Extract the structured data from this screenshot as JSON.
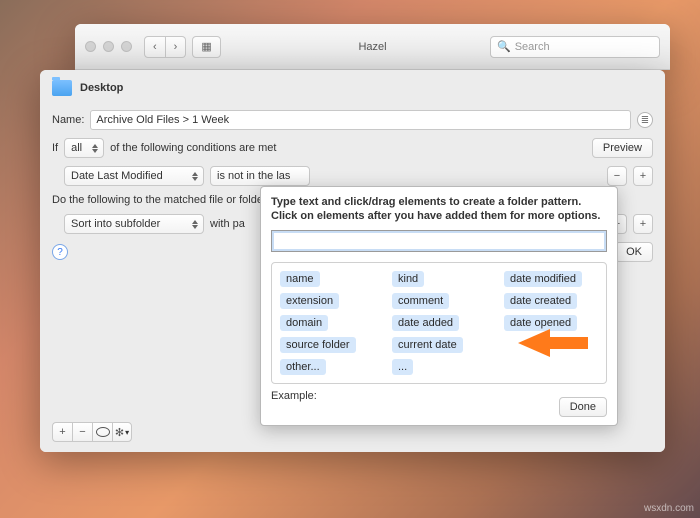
{
  "backWindow": {
    "title": "Hazel",
    "searchPlaceholder": "Search"
  },
  "header": {
    "folder": "Desktop"
  },
  "nameRow": {
    "label": "Name:",
    "value": "Archive Old Files > 1 Week"
  },
  "cond": {
    "ifLabel": "If",
    "allLabel": "all",
    "rest": "of the following conditions are met",
    "previewLabel": "Preview",
    "field": "Date Last Modified",
    "op": "is not in the las"
  },
  "action": {
    "intro": "Do the following to the matched file or folder:",
    "actLabel": "Sort into subfolder",
    "withLabel": "with pa"
  },
  "buttons": {
    "ok": "OK",
    "done": "Done",
    "help": "?",
    "plus": "+",
    "minus": "−",
    "ellipsis": "…",
    "gearChar": "▾"
  },
  "popover": {
    "hint": "Type text and click/drag elements to create a folder pattern. Click on elements after you have added them for more options.",
    "exampleLabel": "Example:",
    "tokens": [
      "name",
      "kind",
      "date modified",
      "extension",
      "comment",
      "date created",
      "domain",
      "date added",
      "date opened",
      "source folder",
      "current date",
      "",
      "other...",
      "...",
      ""
    ]
  },
  "watermark": "wsxdn.com"
}
